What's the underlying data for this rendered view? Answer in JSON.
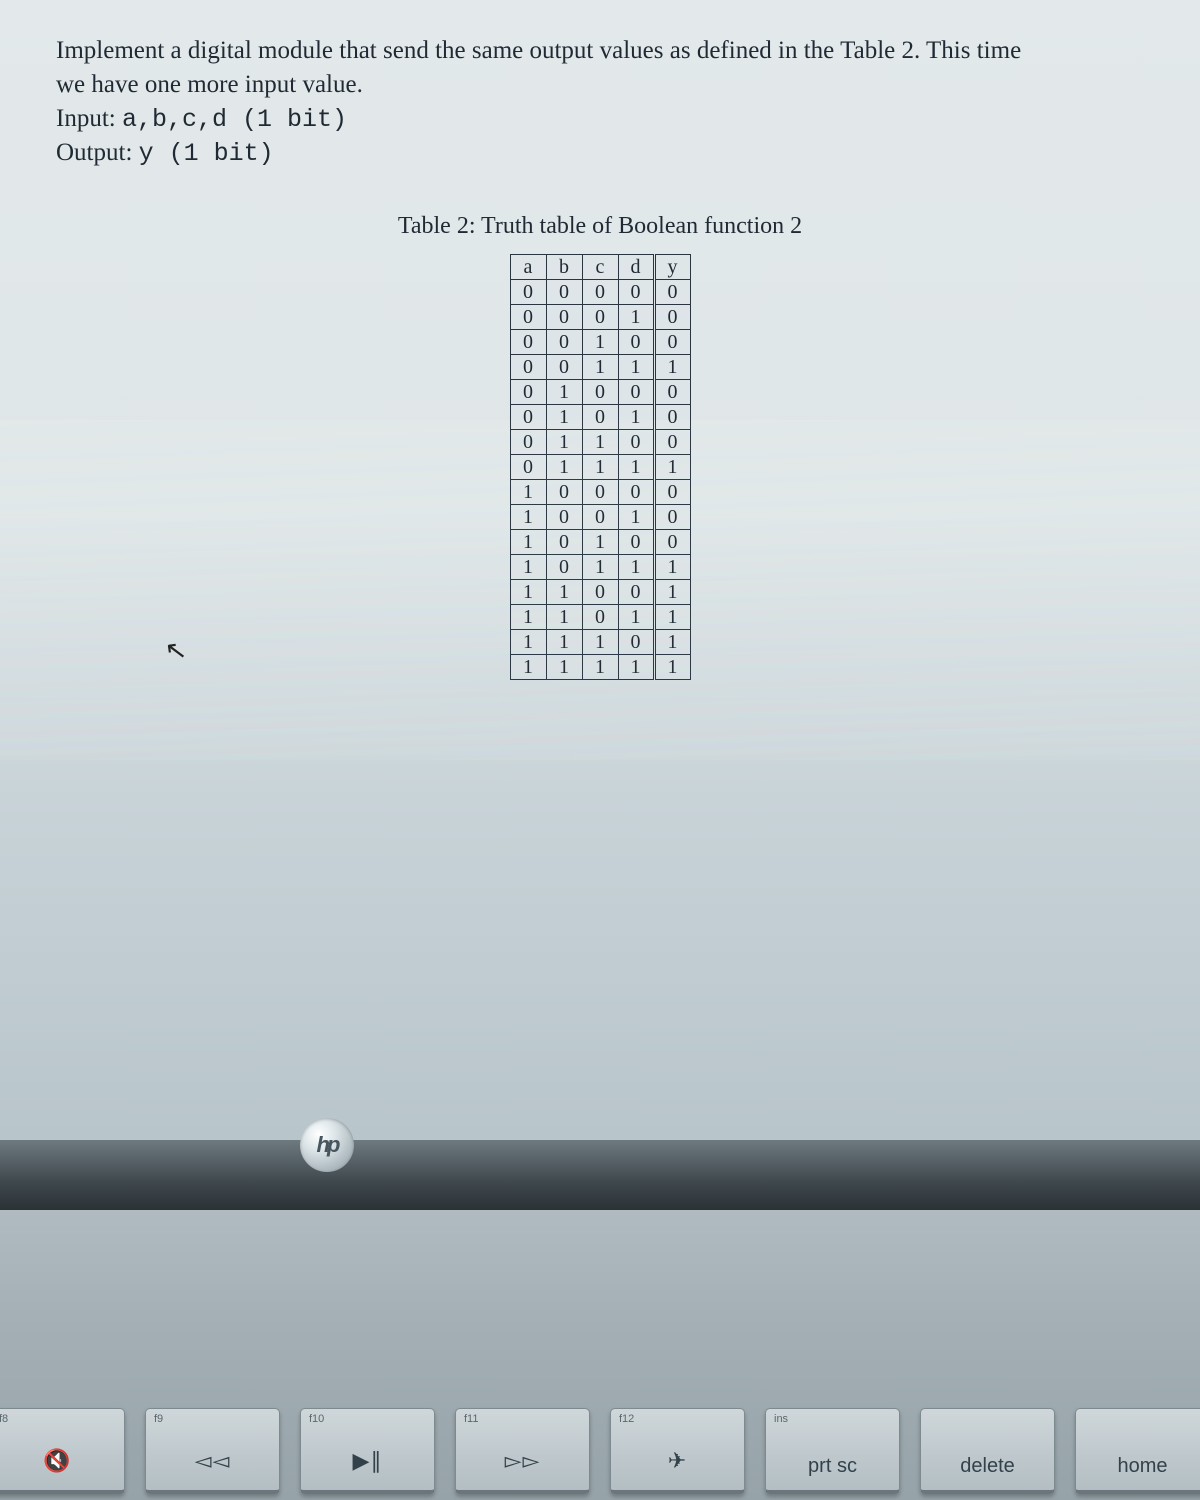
{
  "problem": {
    "line1": "Implement a digital module that send the same output values as defined in the Table 2. This time",
    "line2": "we have one more input value.",
    "input_label": "Input: ",
    "input_value": "a,b,c,d (1 bit)",
    "output_label": "Output: ",
    "output_value": "y (1 bit)"
  },
  "table_caption": "Table 2: Truth table of Boolean function 2",
  "chart_data": {
    "type": "table",
    "columns": [
      "a",
      "b",
      "c",
      "d",
      "y"
    ],
    "rows": [
      [
        0,
        0,
        0,
        0,
        0
      ],
      [
        0,
        0,
        0,
        1,
        0
      ],
      [
        0,
        0,
        1,
        0,
        0
      ],
      [
        0,
        0,
        1,
        1,
        1
      ],
      [
        0,
        1,
        0,
        0,
        0
      ],
      [
        0,
        1,
        0,
        1,
        0
      ],
      [
        0,
        1,
        1,
        0,
        0
      ],
      [
        0,
        1,
        1,
        1,
        1
      ],
      [
        1,
        0,
        0,
        0,
        0
      ],
      [
        1,
        0,
        0,
        1,
        0
      ],
      [
        1,
        0,
        1,
        0,
        0
      ],
      [
        1,
        0,
        1,
        1,
        1
      ],
      [
        1,
        1,
        0,
        0,
        1
      ],
      [
        1,
        1,
        0,
        1,
        1
      ],
      [
        1,
        1,
        1,
        0,
        1
      ],
      [
        1,
        1,
        1,
        1,
        1
      ]
    ]
  },
  "hp_logo": "hp",
  "keys": [
    {
      "small": "f8",
      "glyph": "🔇",
      "name": "key-mute-down"
    },
    {
      "small": "f9",
      "glyph": "◅◅",
      "name": "key-prev-track"
    },
    {
      "small": "f10",
      "glyph": "▶∥",
      "name": "key-play-pause"
    },
    {
      "small": "f11",
      "glyph": "▻▻",
      "name": "key-next-track"
    },
    {
      "small": "f12",
      "glyph": "✈",
      "name": "key-airplane"
    },
    {
      "small": "ins",
      "label": "prt sc",
      "name": "key-print-screen"
    },
    {
      "small": "",
      "label": "delete",
      "name": "key-delete"
    },
    {
      "small": "",
      "label": "home",
      "name": "key-home"
    }
  ]
}
